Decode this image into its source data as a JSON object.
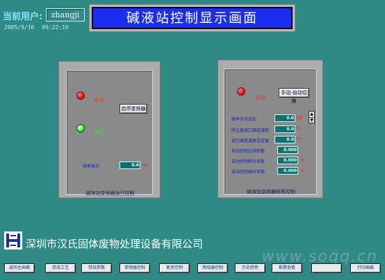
{
  "header": {
    "user_label": "当前用户:",
    "user_name": "zhangji",
    "date": "2005/9/16",
    "time": "09:22:19",
    "title": "碱液站控制显示画面"
  },
  "left_panel": {
    "stop_label": "停止",
    "run_label": "运行",
    "start_stop_button": "启停变频器",
    "freq_display_label": "频率显示",
    "freq_value": "0.0",
    "freq_unit": "Hz",
    "caption": "碱液站变频器运行控制"
  },
  "right_panel": {
    "manual_label": "手动",
    "mode_button": "手动-自动切换",
    "rows": [
      {
        "label": "频率手动设定",
        "value": "0.0",
        "unit": "Hz"
      },
      {
        "label": "除尘器进口烟道温度",
        "value": "0.0",
        "unit": "℃"
      },
      {
        "label": "进口烟道温度设定值",
        "value": "0.0",
        "unit": "℃"
      },
      {
        "label": "自动控制比例参数",
        "value": "0.000",
        "unit": ""
      },
      {
        "label": "自动控制积分参数",
        "value": "0.000",
        "unit": "S"
      },
      {
        "label": "自动控制微分参数",
        "value": "0.000",
        "unit": "S"
      }
    ],
    "spin_up": "▲",
    "spin_down": "▼",
    "caption": "碱液站变频器频率控制"
  },
  "company": "深圳市汉氏固体废物处理设备有限公司",
  "watermark": "www.soqq.cn",
  "nav": [
    "返回主画面",
    "焚烧工艺",
    "焚烧参数",
    "变频器控制",
    "更变控制",
    "燃烧器控制",
    "历史趋势",
    "报警查看",
    "",
    "打印画面"
  ],
  "colors": {
    "background": "#2f8a86",
    "title_bar": "#1a2ef0",
    "lamp_red": "#ff0000",
    "lamp_green": "#33ff33"
  }
}
